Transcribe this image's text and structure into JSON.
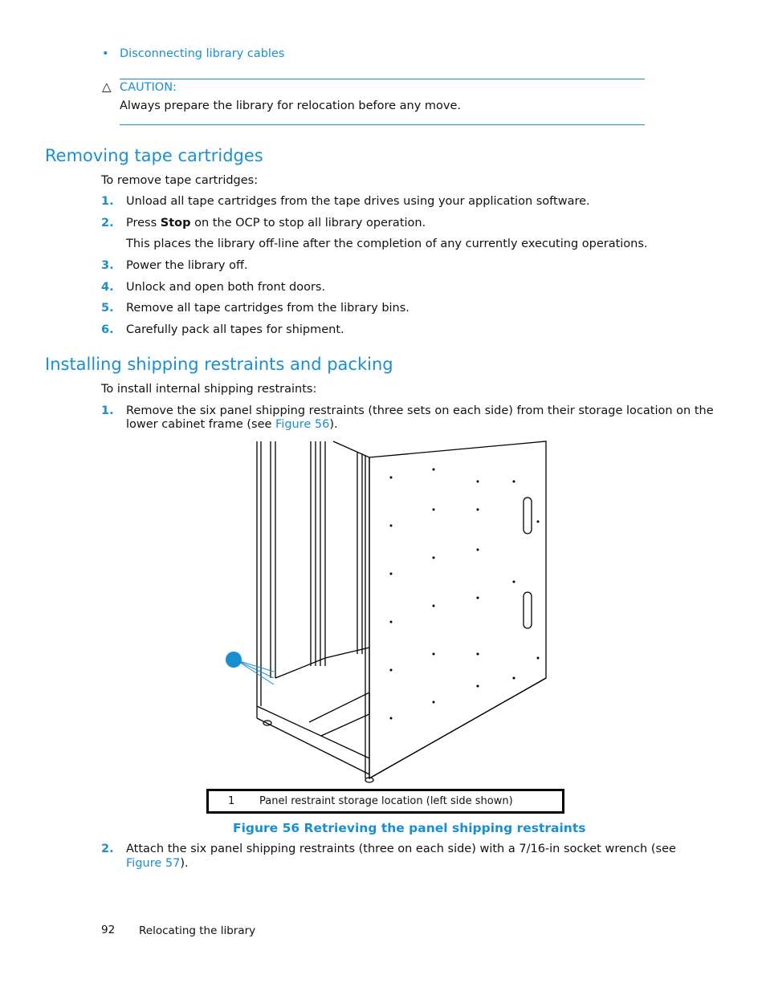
{
  "bullet_link": "Disconnecting library cables",
  "caution": {
    "icon": "warning-triangle-icon",
    "label": "CAUTION:",
    "text": "Always prepare the library for relocation before any move."
  },
  "section1": {
    "title": "Removing tape cartridges",
    "intro": "To remove tape cartridges:",
    "steps": [
      {
        "num": "1.",
        "text": "Unload all tape cartridges from the tape drives using your application software."
      },
      {
        "num": "2.",
        "pre": "Press ",
        "bold": "Stop",
        "post": " on the OCP to stop all library operation.",
        "note": "This places the library off-line after the completion of any currently executing operations."
      },
      {
        "num": "3.",
        "text": "Power the library off."
      },
      {
        "num": "4.",
        "text": "Unlock and open both front doors."
      },
      {
        "num": "5.",
        "text": "Remove all tape cartridges from the library bins."
      },
      {
        "num": "6.",
        "text": "Carefully pack all tapes for shipment."
      }
    ]
  },
  "section2": {
    "title": "Installing shipping restraints and packing",
    "intro": "To install internal shipping restraints:",
    "step1": {
      "num": "1.",
      "line1": "Remove the six panel shipping restraints (three sets on each side) from their storage location on the",
      "line2_pre": "lower cabinet frame (see ",
      "link": "Figure 56",
      "line2_post": ")."
    },
    "figure": {
      "callout": "1",
      "legend_num": "1",
      "legend_text": "Panel restraint storage location (left side shown)",
      "caption": "Figure 56 Retrieving the panel shipping restraints"
    },
    "step2": {
      "num": "2.",
      "line1": "Attach the six panel shipping restraints (three on each side) with a 7/16-in socket wrench (see",
      "link": "Figure 57",
      "post": ")."
    }
  },
  "footer": {
    "page": "92",
    "title": "Relocating the library"
  },
  "colors": {
    "accent": "#1a8fd0"
  }
}
